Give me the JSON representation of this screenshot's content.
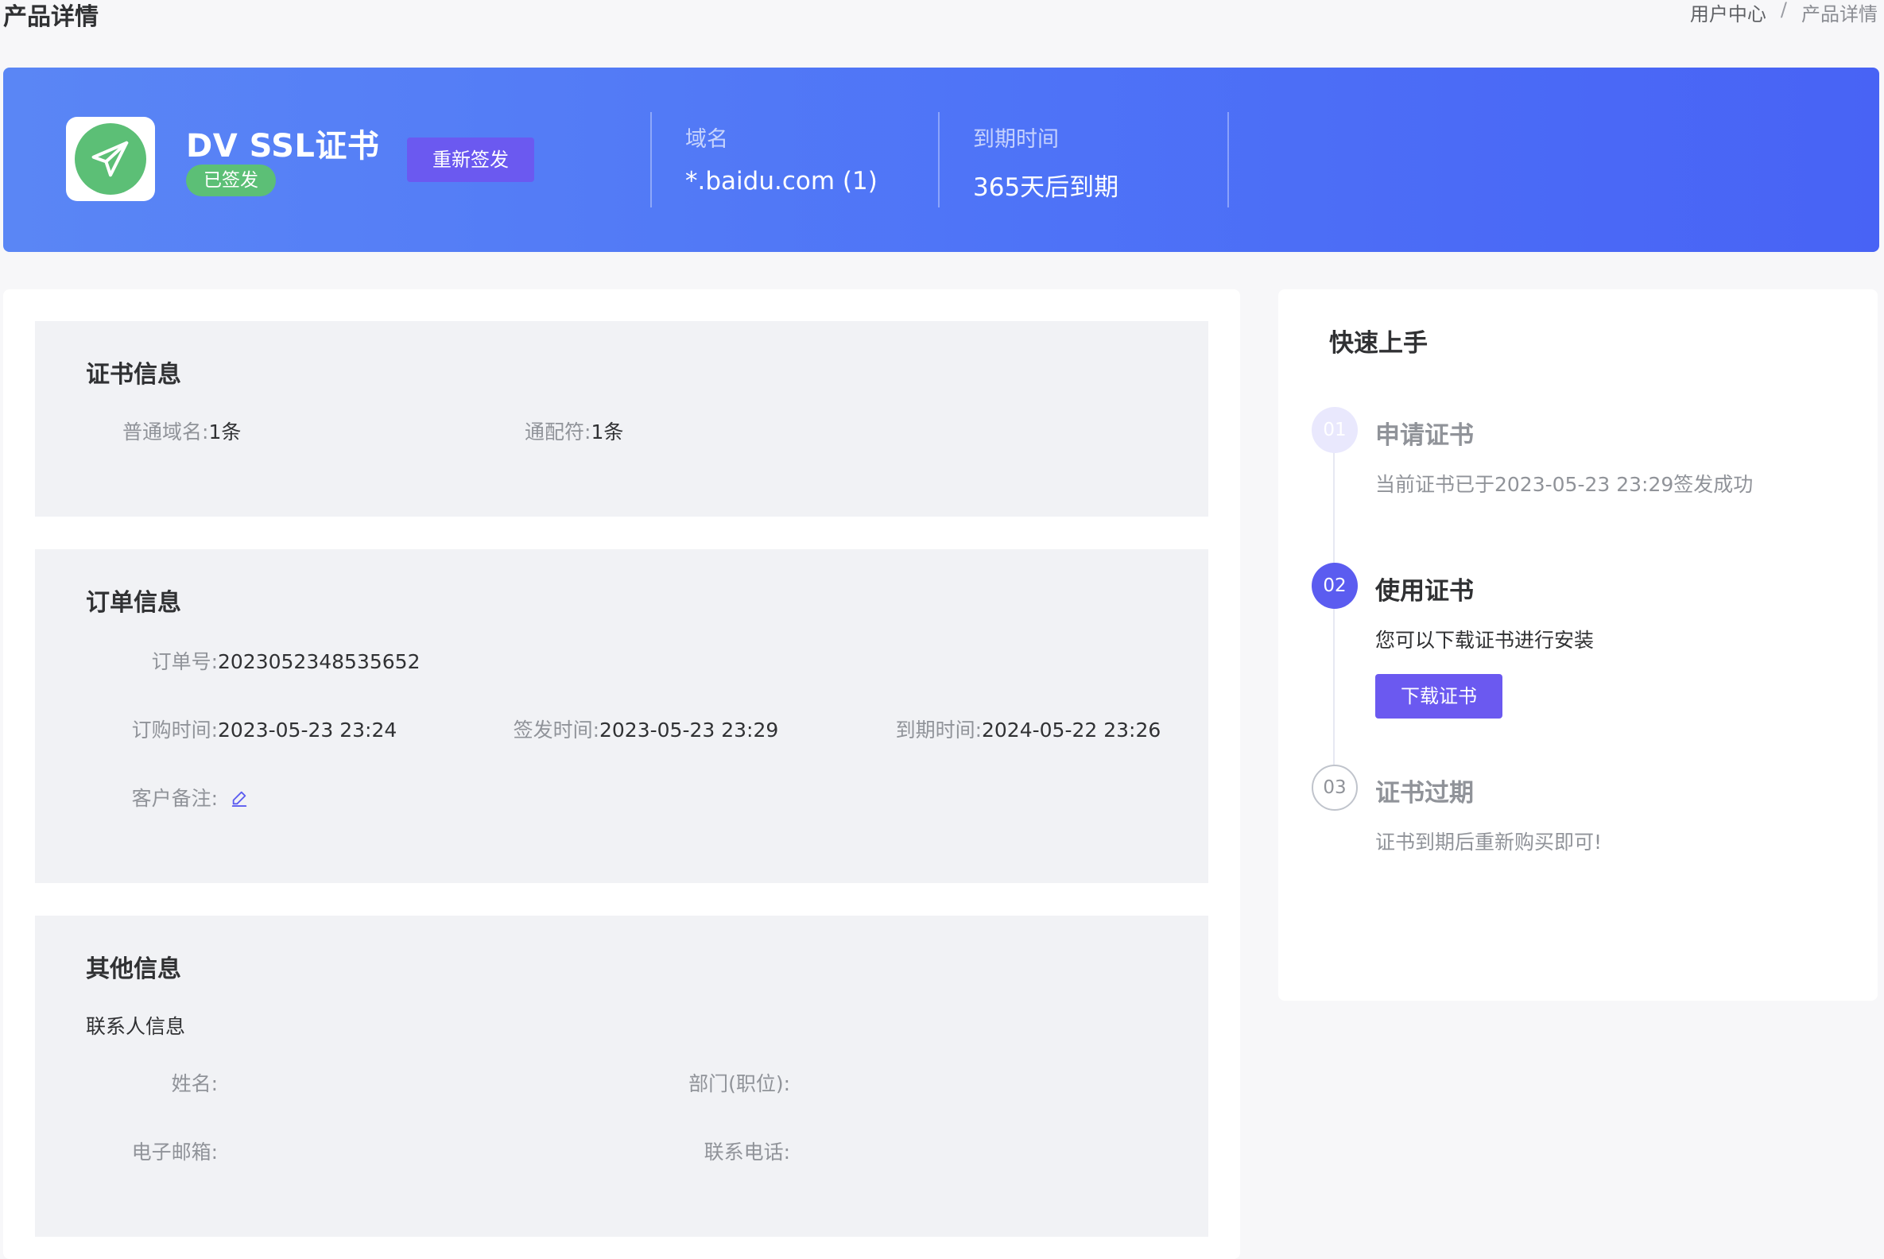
{
  "header": {
    "title": "产品详情",
    "breadcrumb": [
      "用户中心",
      "/",
      "产品详情"
    ]
  },
  "banner": {
    "product_name": "DV SSL证书",
    "status": "已签发",
    "reissue_label": "重新签发",
    "domain_label": "域名",
    "domain_value": "*.baidu.com (1)",
    "expiry_label": "到期时间",
    "expiry_value": "365天后到期",
    "logo_icon": "paper-plane-icon",
    "colors": {
      "banner_start": "#5a86f5",
      "banner_end": "#4863f5",
      "status_green": "#5cbf76",
      "accent_purple": "#6b59f0"
    }
  },
  "cert_info": {
    "title": "证书信息",
    "normal_domain_label": "普通域名:",
    "normal_domain_value": "1条",
    "wildcard_label": "通配符:",
    "wildcard_value": "1条"
  },
  "order_info": {
    "title": "订单信息",
    "order_no_label": "订单号:",
    "order_no_value": "2023052348535652",
    "order_time_label": "订购时间:",
    "order_time_value": "2023-05-23 23:24",
    "issue_time_label": "签发时间:",
    "issue_time_value": "2023-05-23 23:29",
    "expire_time_label": "到期时间:",
    "expire_time_value": "2024-05-22 23:26",
    "remark_label": "客户备注:",
    "remark_icon": "edit-icon"
  },
  "other_info": {
    "title": "其他信息",
    "contact_label": "联系人信息",
    "name_label": "姓名:",
    "dept_label": "部门(职位):",
    "email_label": "电子邮箱:",
    "phone_label": "联系电话:"
  },
  "quick_start": {
    "title": "快速上手",
    "steps": [
      {
        "num": "01",
        "title": "申请证书",
        "desc": "当前证书已于2023-05-23 23:29签发成功"
      },
      {
        "num": "02",
        "title": "使用证书",
        "desc": "您可以下载证书进行安装",
        "button": "下载证书"
      },
      {
        "num": "03",
        "title": "证书过期",
        "desc": "证书到期后重新购买即可!"
      }
    ]
  }
}
